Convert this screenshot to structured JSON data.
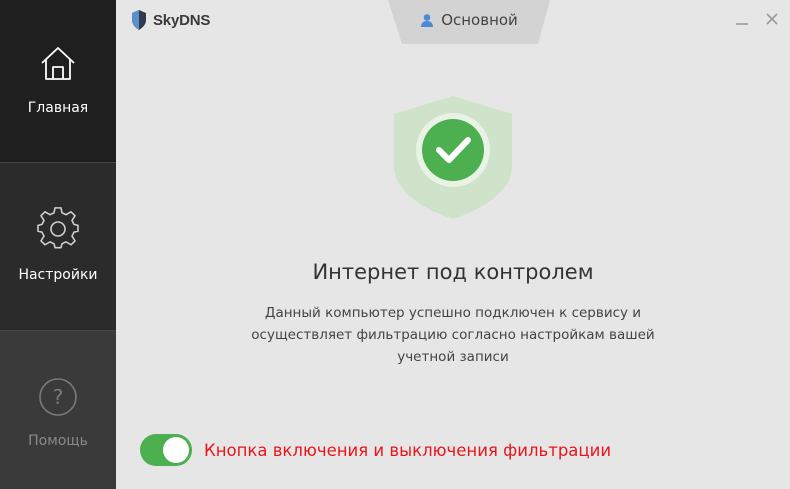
{
  "app": {
    "title": "SkyDNS"
  },
  "sidebar": {
    "items": [
      {
        "label": "Главная",
        "icon": "home-icon"
      },
      {
        "label": "Настройки",
        "icon": "gear-icon"
      },
      {
        "label": "Помощь",
        "icon": "help-icon"
      }
    ]
  },
  "header": {
    "profile_tab": {
      "label": "Основной",
      "icon": "user-icon"
    },
    "controls": [
      "minimize-icon",
      "close-icon"
    ]
  },
  "main": {
    "status_icon": "shield-check-icon",
    "status_title": "Интернет под контролем",
    "status_desc_lines": [
      "Данный компьютер успешно подключен к сервису и",
      "осуществляет фильтрацию согласно настройкам вашей",
      "учетной записи"
    ],
    "filter_toggle": {
      "state": "on",
      "label": "Кнопка включения и выключения фильтрации"
    }
  },
  "colors": {
    "sidebar_bg": "#2b2b2b",
    "content_bg": "#e6e6e6",
    "accent_green": "#4caf50",
    "shield_light": "#cfe3cb",
    "warning_red": "#e8161c"
  }
}
